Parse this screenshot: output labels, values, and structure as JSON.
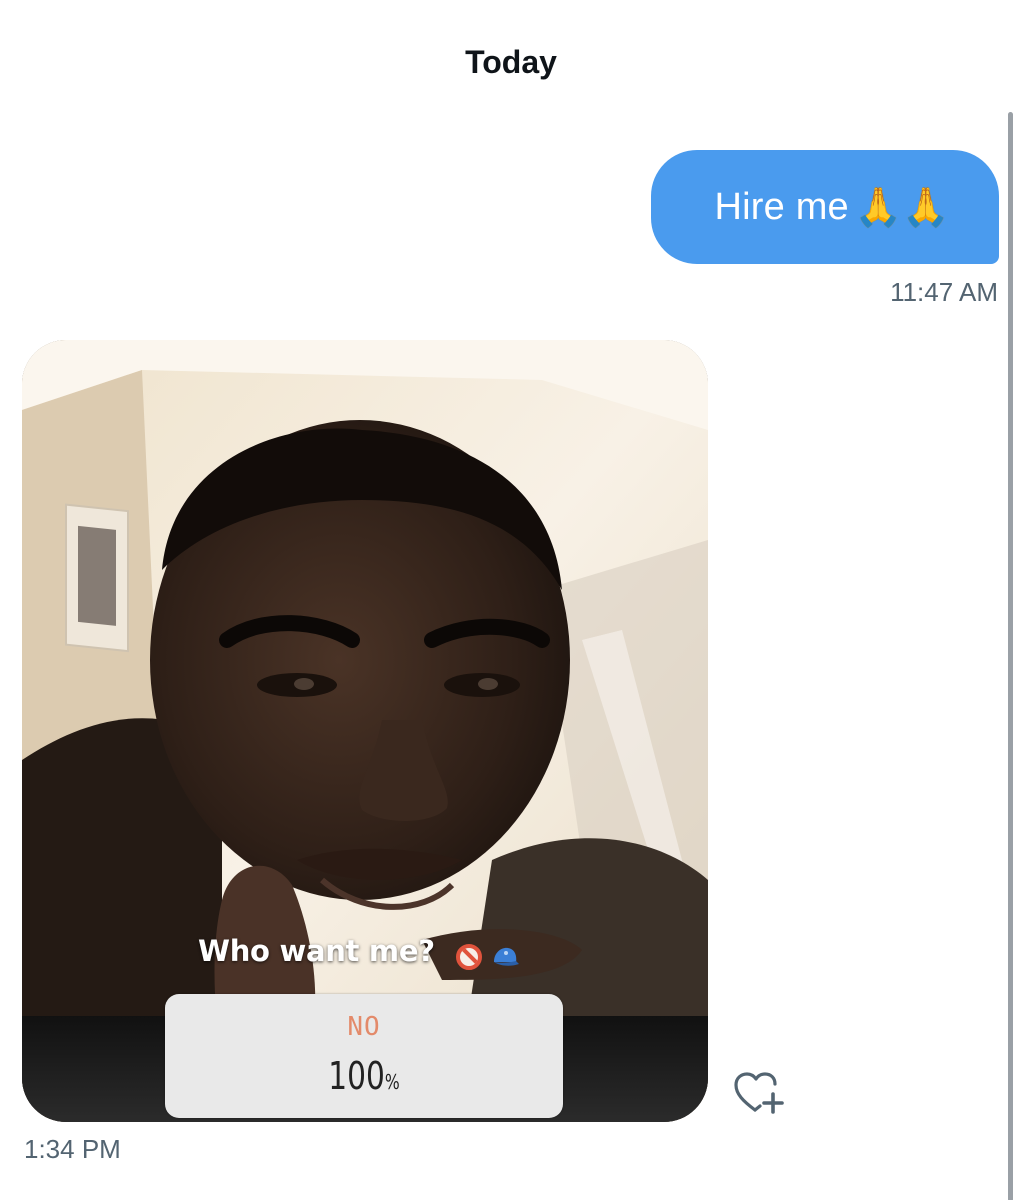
{
  "conversation": {
    "date_header": "Today"
  },
  "messages": [
    {
      "direction": "sent",
      "text": "Hire me",
      "emoji": "🙏🙏",
      "time": "11:47 AM"
    },
    {
      "direction": "received",
      "type": "story_image",
      "caption": "Who want me?",
      "poll": {
        "option": "NO",
        "percent_number": "100",
        "percent_sign": "%"
      },
      "time": "1:34 PM"
    }
  ],
  "icons": {
    "react": "heart-plus-icon",
    "prohibited": "no-entry-icon",
    "cap": "blue-cap-icon"
  },
  "colors": {
    "sent_bubble": "#4a9bee",
    "timestamp": "#536471",
    "poll_option": "#e38a6a"
  }
}
